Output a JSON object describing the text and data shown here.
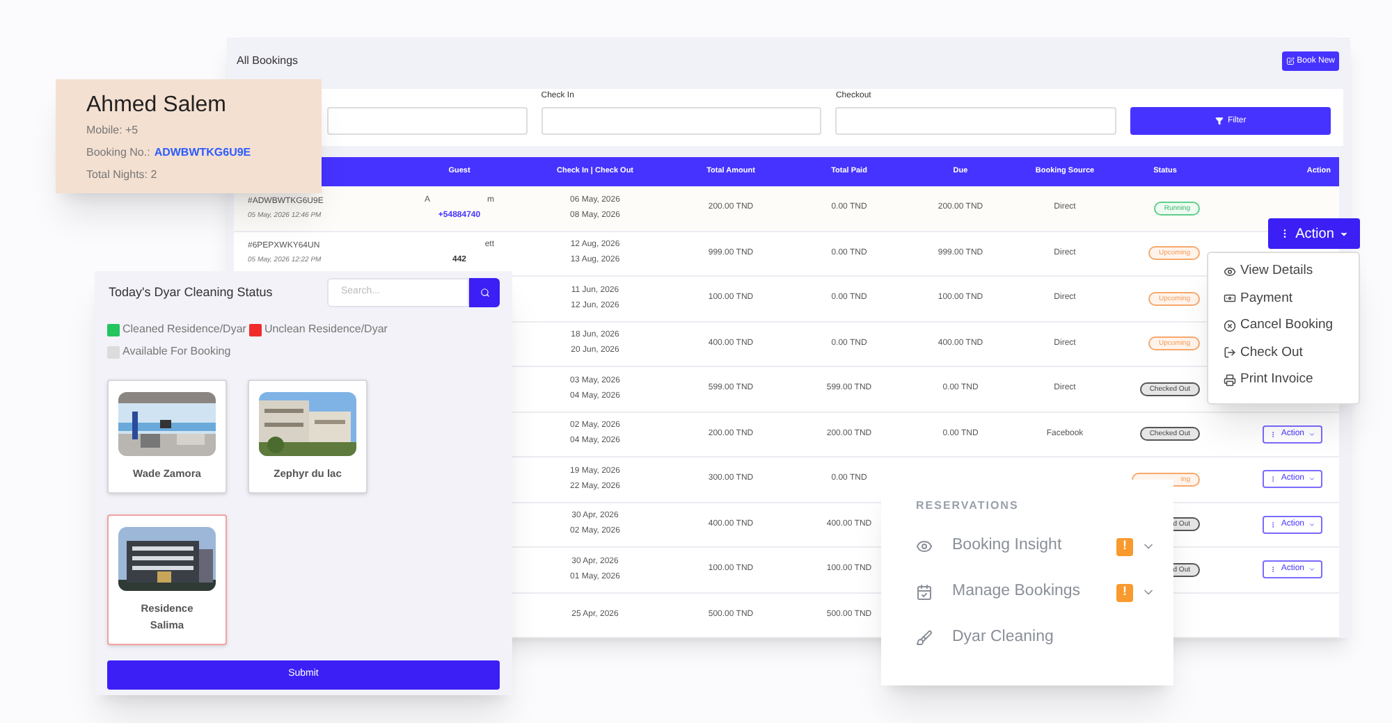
{
  "bookings": {
    "title": "All Bookings",
    "book_new": "Book New",
    "filters": [
      {
        "label": "Check In"
      },
      {
        "label": "Checkout"
      }
    ],
    "filter_button": "Filter",
    "columns": [
      "",
      "Guest",
      "Check In | Check Out",
      "Total Amount",
      "Total Paid",
      "Due",
      "Booking Source",
      "Status",
      "Action"
    ],
    "rows": [
      {
        "booking_no": "#ADWBWTKG6U9E",
        "booked_at": "05 May, 2026 12:46 PM",
        "guest_name_start": "A",
        "guest_name_end": "m",
        "guest_phone": "+54884740",
        "check_in": "06 May, 2026",
        "check_out": "08 May, 2026",
        "total_amount": "200.00 TND",
        "total_paid": "0.00 TND",
        "due": "200.00 TND",
        "source": "Direct",
        "status": {
          "text": "Running",
          "kind": "running"
        }
      },
      {
        "booking_no": "#6PEPXWKY64UN",
        "booked_at": "05 May, 2026 12:22 PM",
        "guest_name_end": "ett",
        "guest_phone": "442",
        "check_in": "12 Aug, 2026",
        "check_out": "13 Aug, 2026",
        "total_amount": "999.00 TND",
        "total_paid": "0.00 TND",
        "due": "999.00 TND",
        "source": "Direct",
        "status": {
          "text": "Upcoming",
          "kind": "upcoming"
        }
      },
      {
        "check_in": "11 Jun, 2026",
        "check_out": "12 Jun, 2026",
        "total_amount": "100.00 TND",
        "total_paid": "0.00 TND",
        "due": "100.00 TND",
        "source": "Direct",
        "status": {
          "text": "Upcoming",
          "kind": "upcoming"
        }
      },
      {
        "check_in": "18 Jun, 2026",
        "check_out": "20 Jun, 2026",
        "total_amount": "400.00 TND",
        "total_paid": "0.00 TND",
        "due": "400.00 TND",
        "source": "Direct",
        "status": {
          "text": "Upcoming",
          "kind": "upcoming"
        }
      },
      {
        "check_in": "03 May, 2026",
        "check_out": "04 May, 2026",
        "total_amount": "599.00 TND",
        "total_paid": "599.00 TND",
        "due": "0.00 TND",
        "source": "Direct",
        "status": {
          "text": "Checked Out",
          "kind": "checked_out"
        }
      },
      {
        "check_in": "02 May, 2026",
        "check_out": "04 May, 2026",
        "total_amount": "200.00 TND",
        "total_paid": "200.00 TND",
        "due": "0.00 TND",
        "source": "Facebook",
        "status": {
          "text": "Checked Out",
          "kind": "checked_out"
        },
        "action": "Action"
      },
      {
        "check_in": "19 May, 2026",
        "check_out": "22 May, 2026",
        "total_amount": "300.00 TND",
        "total_paid": "0.00 TND",
        "status": {
          "text": "ing",
          "kind": "upcoming"
        },
        "action": "Action"
      },
      {
        "check_in": "30 Apr, 2026",
        "check_out": "02 May, 2026",
        "total_amount": "400.00 TND",
        "total_paid": "400.00 TND",
        "status": {
          "text": "d Out",
          "kind": "checked_out"
        },
        "action": "Action"
      },
      {
        "check_in": "30 Apr, 2026",
        "check_out": "01 May, 2026",
        "total_amount": "100.00 TND",
        "total_paid": "100.00 TND",
        "status": {
          "text": "d Out",
          "kind": "checked_out"
        },
        "action": "Action"
      },
      {
        "check_in": "25 Apr, 2026",
        "total_amount": "500.00 TND",
        "total_paid": "500.00 TND"
      }
    ]
  },
  "guest_card": {
    "name": "Ahmed Salem",
    "mobile": "Mobile: +5",
    "booking_label": "Booking No.:",
    "booking_no": "ADWBWTKG6U9E",
    "nights": "Total Nights: 2"
  },
  "action_menu": {
    "button": "Action",
    "items": [
      {
        "label": "View Details",
        "kind": "view"
      },
      {
        "label": "Payment",
        "kind": "payment"
      },
      {
        "label": "Cancel Booking",
        "kind": "cancel"
      },
      {
        "label": "Check Out",
        "kind": "checkout"
      },
      {
        "label": "Print Invoice",
        "kind": "print"
      }
    ]
  },
  "cleaning": {
    "title": "Today's Dyar Cleaning Status",
    "search": {
      "placeholder": "Search..."
    },
    "legend": [
      {
        "label": "Cleaned Residence/Dyar",
        "color": "#22c55e"
      },
      {
        "label": "Unclean Residence/Dyar",
        "color": "#ef2b2b"
      },
      {
        "label": "Available For Booking",
        "color": "#dcdcdc"
      }
    ],
    "residences": [
      {
        "name": "Wade Zamora",
        "kind": "available"
      },
      {
        "name": "Zephyr du lac",
        "kind": "available"
      },
      {
        "name": "Residence Salima",
        "kind": "unclean"
      }
    ],
    "submit": "Submit"
  },
  "nav": {
    "section": "RESERVATIONS",
    "items": [
      {
        "label": "Booking Insight",
        "kind": "insight",
        "badge": "!"
      },
      {
        "label": "Manage Bookings",
        "kind": "manage",
        "badge": "!"
      },
      {
        "label": "Dyar Cleaning",
        "kind": "cleaning"
      }
    ]
  }
}
